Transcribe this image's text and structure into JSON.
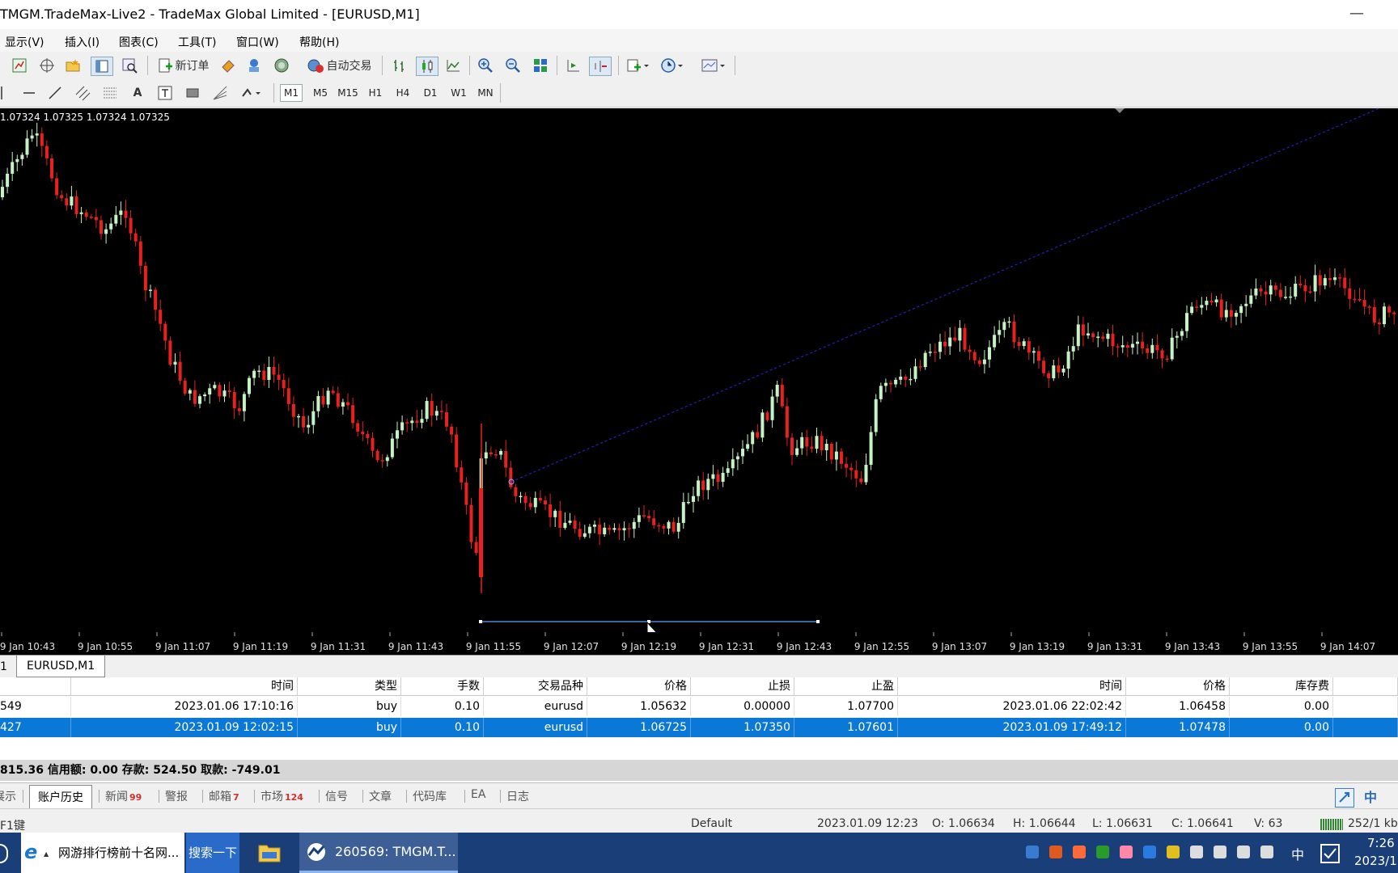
{
  "window": {
    "title": "TMGM.TradeMax-Live2 - TradeMax Global Limited - [EURUSD,M1]",
    "minimize": "—",
    "maximize": "□"
  },
  "menu": [
    "显示(V)",
    "插入(I)",
    "图表(C)",
    "工具(T)",
    "窗口(W)",
    "帮助(H)"
  ],
  "toolbar": {
    "new_order_label": "新订单",
    "auto_trade_label": "自动交易"
  },
  "timeframes": [
    "M1",
    "M5",
    "M15",
    "H1",
    "H4",
    "D1",
    "W1",
    "MN"
  ],
  "active_timeframe": "M1",
  "chart": {
    "ohlc_text": "1.07324 1.07325 1.07324 1.07325",
    "time_labels": [
      "9 Jan 10:43",
      "9 Jan 10:55",
      "9 Jan 11:07",
      "9 Jan 11:19",
      "9 Jan 11:31",
      "9 Jan 11:43",
      "9 Jan 11:55",
      "9 Jan 12:07",
      "9 Jan 12:19",
      "9 Jan 12:31",
      "9 Jan 12:43",
      "9 Jan 12:55",
      "9 Jan 13:07",
      "9 Jan 13:19",
      "9 Jan 13:31",
      "9 Jan 13:43",
      "9 Jan 13:55",
      "9 Jan 14:07"
    ],
    "bull_color": "#c6f3c6",
    "bear_color": "#e82020",
    "trend_line_color": "#2020c0",
    "hline_color": "#60a0ff"
  },
  "chart_tabs": {
    "left_fragment": "1",
    "active": "EURUSD,M1"
  },
  "terminal": {
    "headers": [
      "时间",
      "类型",
      "手数",
      "交易品种",
      "价格",
      "止损",
      "止盈",
      "时间",
      "价格",
      "库存费"
    ],
    "rows": [
      {
        "order": "549",
        "open_time": "2023.01.06 17:10:16",
        "type": "buy",
        "lots": "0.10",
        "symbol": "eurusd",
        "price": "1.05632",
        "sl": "0.00000",
        "tp": "1.07700",
        "close_time": "2023.01.06 22:02:42",
        "close_price": "1.06458",
        "swap": "0.00"
      },
      {
        "order": "427",
        "open_time": "2023.01.09 12:02:15",
        "type": "buy",
        "lots": "0.10",
        "symbol": "eurusd",
        "price": "1.06725",
        "sl": "1.07350",
        "tp": "1.07601",
        "close_time": "2023.01.09 17:49:12",
        "close_price": "1.07478",
        "swap": "0.00"
      }
    ],
    "balance_line": "815.36  信用额: 0.00  存款: 524.50  取款: -749.01",
    "selection_color": "#0a78d7"
  },
  "bottom_tabs": [
    {
      "label": "展示",
      "badge": ""
    },
    {
      "label": "账户历史",
      "badge": ""
    },
    {
      "label": "新闻",
      "badge": "99"
    },
    {
      "label": "警报",
      "badge": ""
    },
    {
      "label": "邮箱",
      "badge": "7"
    },
    {
      "label": "市场",
      "badge": "124"
    },
    {
      "label": "信号",
      "badge": ""
    },
    {
      "label": "文章",
      "badge": ""
    },
    {
      "label": "代码库",
      "badge": ""
    },
    {
      "label": "EA",
      "badge": ""
    },
    {
      "label": "日志",
      "badge": ""
    }
  ],
  "bottom_tab_active": "账户历史",
  "status_bar": {
    "help": "F1键",
    "profile": "Default",
    "datetime": "2023.01.09 12:23",
    "open": "O: 1.06634",
    "high": "H: 1.06644",
    "low": "L: 1.06631",
    "close": "C: 1.06641",
    "volume": "V: 63",
    "traffic": "252/1 kb"
  },
  "taskbar": {
    "browser_title": "网游排行榜前十名网...",
    "search_button": "搜索一下",
    "app_title": "260569: TMGM.T...",
    "ime": "中",
    "time": "7:26",
    "date": "2023/1"
  }
}
